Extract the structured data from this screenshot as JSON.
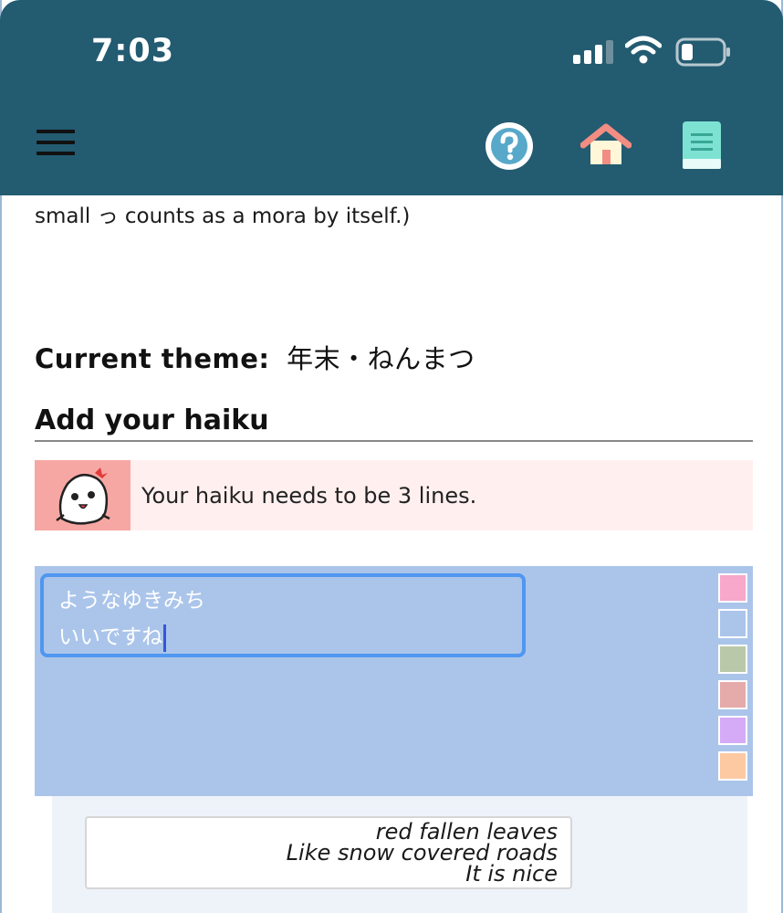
{
  "status_bar": {
    "time": "7:03"
  },
  "header": {
    "icons": [
      "menu-icon",
      "help-icon",
      "home-icon",
      "book-icon"
    ],
    "colors": {
      "background": "#235b71",
      "help": "#58a8c9",
      "home_roof": "#f28d83",
      "book": "#7ee2d3"
    }
  },
  "intro": {
    "text": "small っ counts as a mora by itself.)"
  },
  "theme": {
    "label": "Current theme:",
    "value": "年末・ねんまつ"
  },
  "add_section": {
    "heading": "Add your haiku",
    "alert_message": "Your haiku needs to be 3 lines."
  },
  "editor": {
    "line1": "ようなゆきみち",
    "line2": "いいですね",
    "background_color": "#abc5ea",
    "swatches": [
      "#f7a8cb",
      "#abc5ea",
      "#b9c8a9",
      "#e5aaaa",
      "#d5aaf6",
      "#fcc9a3"
    ]
  },
  "preview": {
    "lines": [
      "red fallen leaves",
      "Like snow covered roads",
      "It is nice"
    ]
  }
}
